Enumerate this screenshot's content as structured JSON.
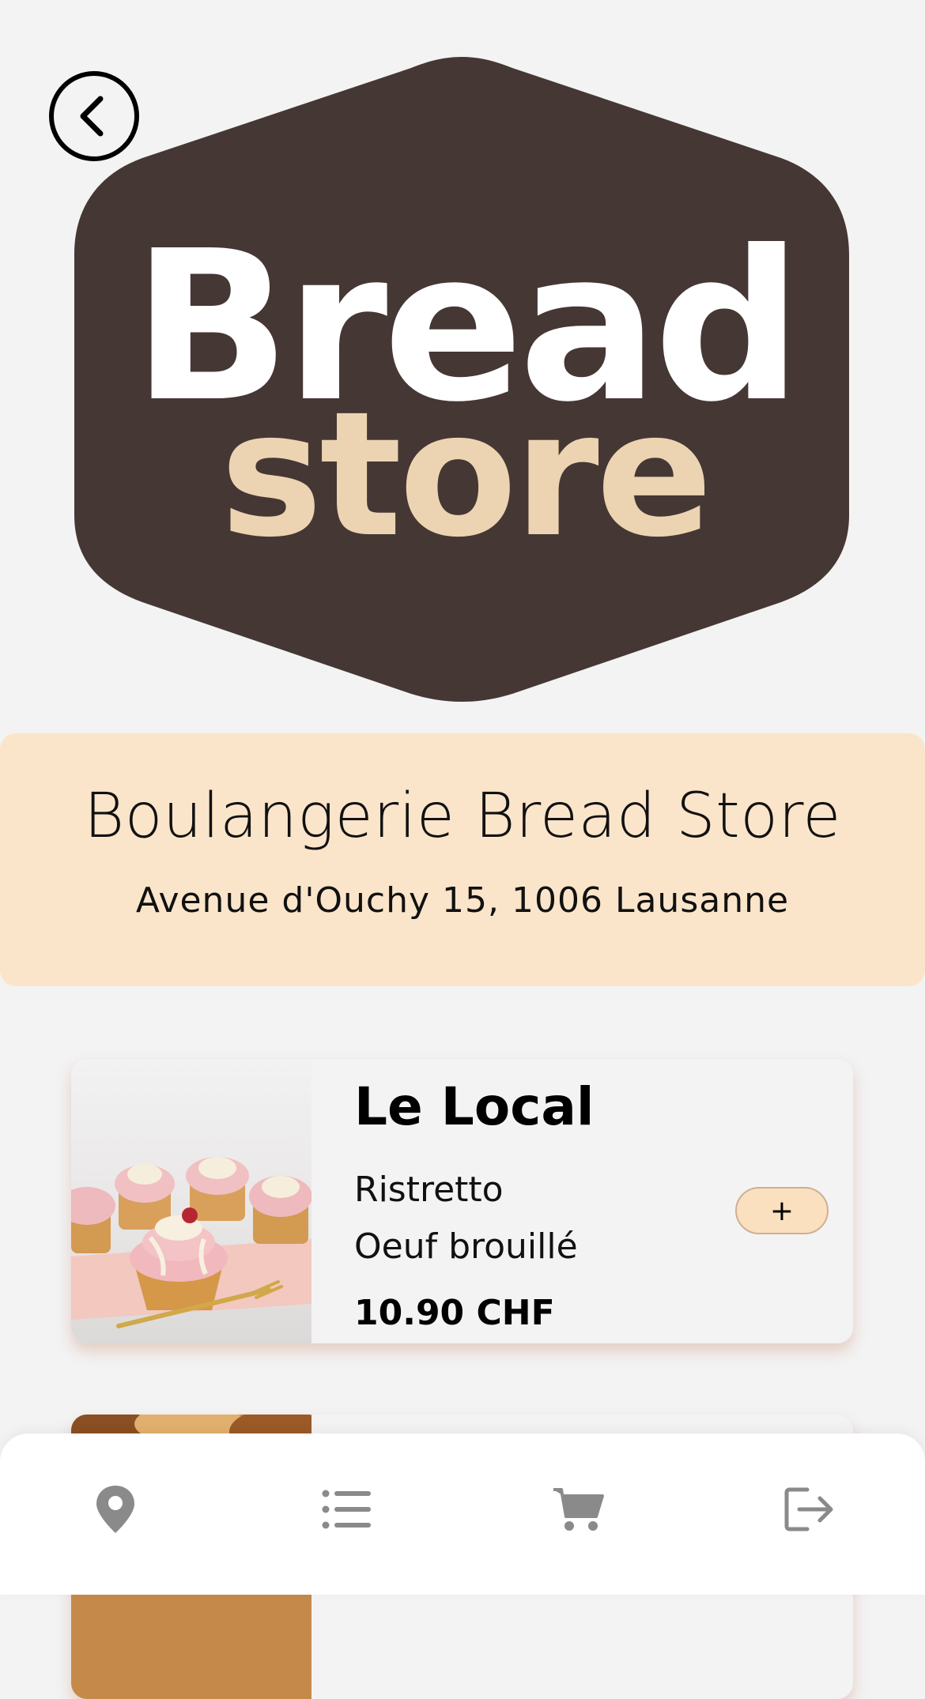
{
  "logo": {
    "word1": "Bread",
    "word2": "store"
  },
  "store": {
    "name": "Boulangerie Bread Store",
    "address": "Avenue d'Ouchy 15, 1006 Lausanne"
  },
  "products": [
    {
      "title": "Le Local",
      "items": [
        "Ristretto",
        "Oeuf brouillé"
      ],
      "price": "10.90 CHF",
      "add_label": "+"
    }
  ],
  "nav": {
    "items": [
      {
        "icon": "location-pin-icon"
      },
      {
        "icon": "list-icon"
      },
      {
        "icon": "cart-icon"
      },
      {
        "icon": "logout-icon"
      }
    ]
  },
  "colors": {
    "background": "#f3f3f3",
    "logo_badge": "#453734",
    "logo_text_primary": "#ffffff",
    "logo_text_secondary": "#ecd4b2",
    "panel": "#fbe5ca",
    "add_button": "#fbe0bf",
    "nav_icon": "#8a8a8a"
  }
}
